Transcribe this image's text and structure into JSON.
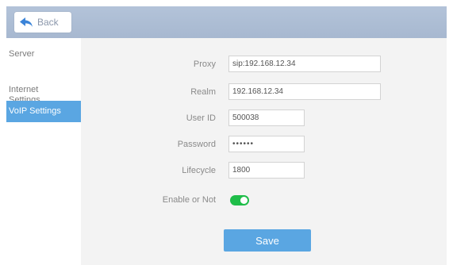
{
  "header": {
    "back_label": "Back"
  },
  "sidebar": {
    "items": [
      {
        "label": "Server"
      },
      {
        "label": "Internet\nSettings"
      },
      {
        "label": "VoIP Settings",
        "active": true
      }
    ]
  },
  "form": {
    "proxy": {
      "label": "Proxy",
      "value": "sip:192.168.12.34"
    },
    "realm": {
      "label": "Realm",
      "value": "192.168.12.34"
    },
    "user_id": {
      "label": "User ID",
      "value": "500038"
    },
    "password": {
      "label": "Password",
      "value": "••••••"
    },
    "lifecycle": {
      "label": "Lifecycle",
      "value": "1800"
    },
    "enable": {
      "label": "Enable or Not",
      "on": true
    },
    "save_label": "Save"
  },
  "colors": {
    "accent": "#5aa6e2",
    "toggle_on": "#1fbd49",
    "header": "#b0c0d6"
  }
}
